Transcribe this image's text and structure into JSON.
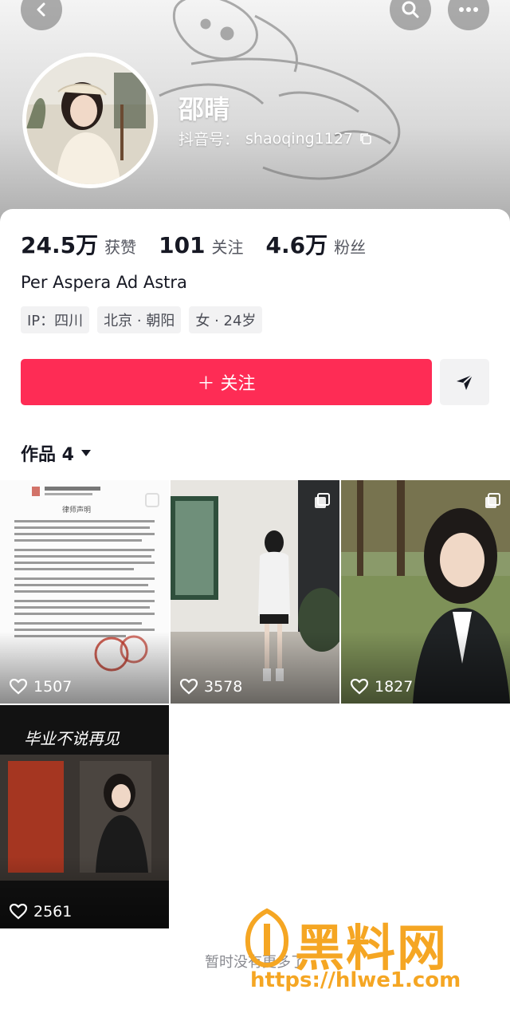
{
  "header": {
    "name": "邵晴",
    "uid_label": "抖音号：",
    "uid": "shaoqing1127"
  },
  "stats": [
    {
      "value": "24.5万",
      "label": "获赞"
    },
    {
      "value": "101",
      "label": "关注"
    },
    {
      "value": "4.6万",
      "label": "粉丝"
    }
  ],
  "bio": "Per Aspera Ad Astra",
  "tags": [
    "IP：四川",
    "北京 · 朝阳",
    "女 · 24岁"
  ],
  "actions": {
    "follow_label": "＋ 关注"
  },
  "works": {
    "label": "作品 4",
    "items": [
      {
        "likes": "1507",
        "icon": "heart-icon",
        "doc_title": "律师声明",
        "multi": false
      },
      {
        "likes": "3578",
        "icon": "heart-icon",
        "multi": true
      },
      {
        "likes": "1827",
        "icon": "heart-icon",
        "multi": true
      },
      {
        "likes": "2561",
        "icon": "heart-icon",
        "overlay_title": "毕业不说再见",
        "multi": false
      }
    ]
  },
  "footer_note": "暂时没有更多了",
  "watermark": {
    "brand": "黑料网",
    "url": "https://hlwe1.com"
  },
  "colors": {
    "accent": "#fe2c55",
    "watermark": "#f5a623"
  }
}
